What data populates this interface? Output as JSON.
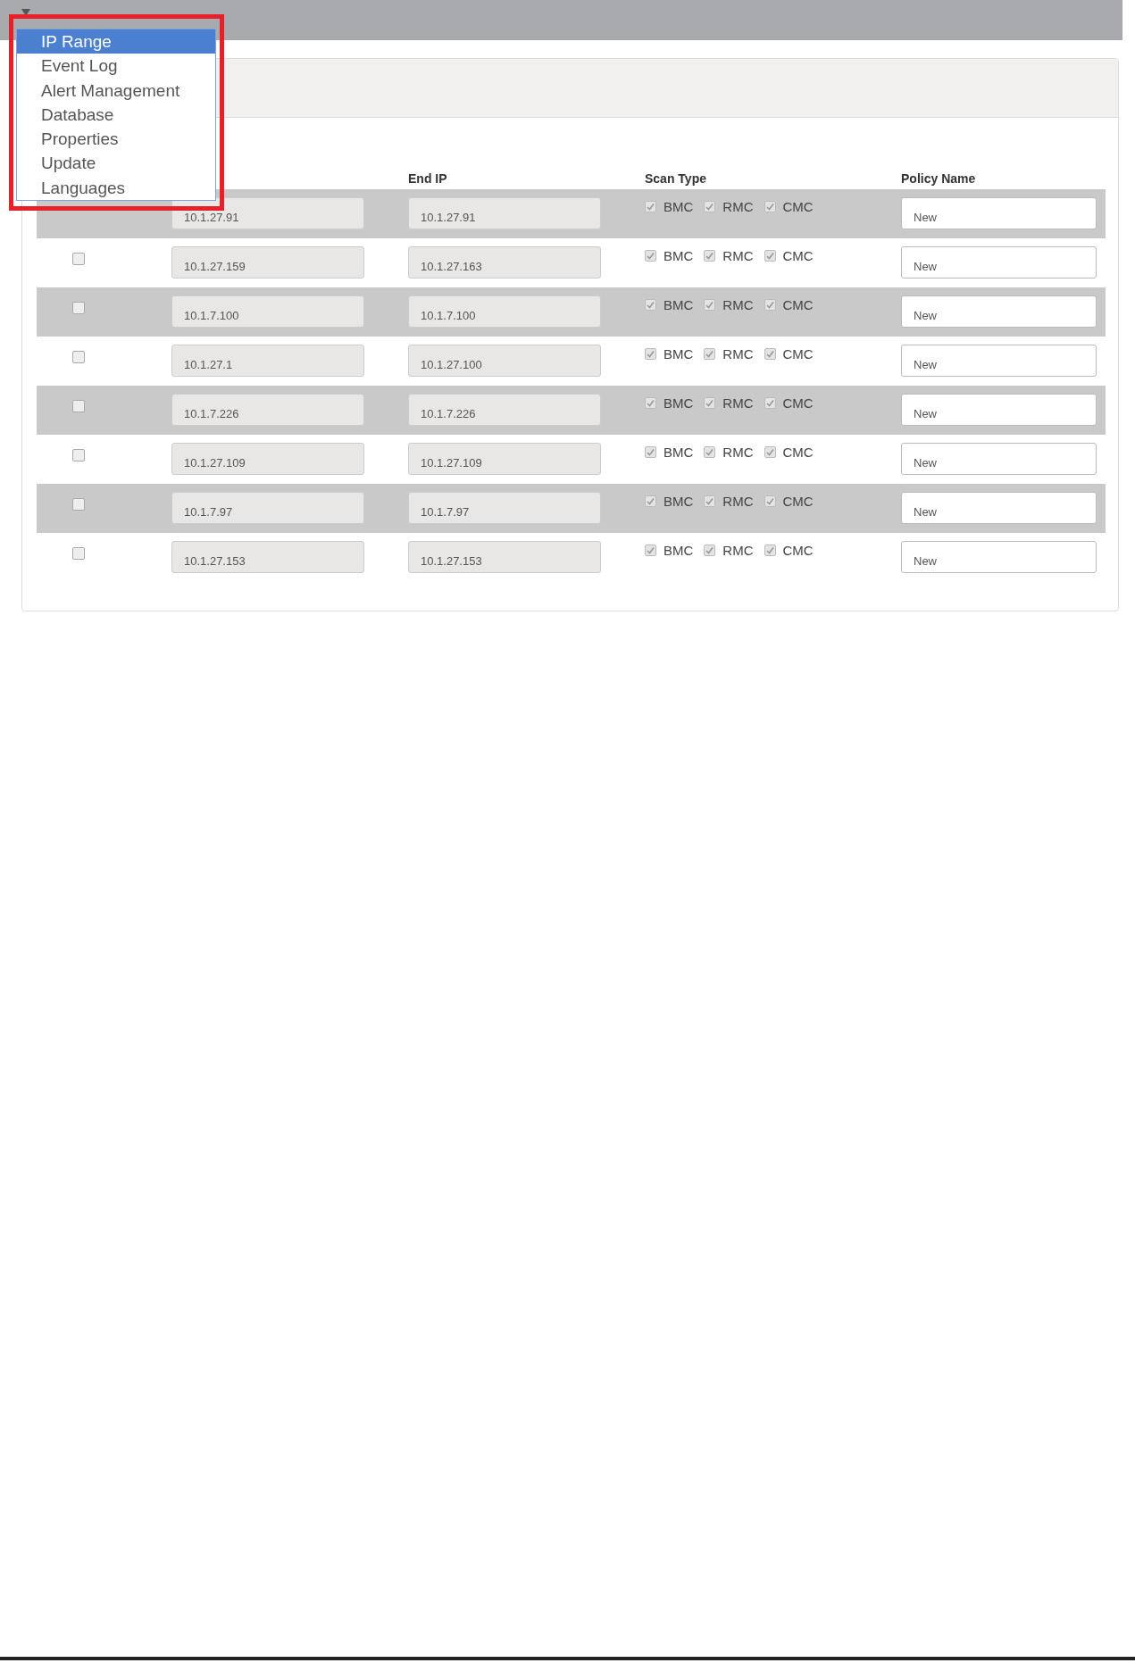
{
  "dropdown": {
    "items": [
      {
        "label": "IP Range",
        "selected": true
      },
      {
        "label": "Event Log",
        "selected": false
      },
      {
        "label": "Alert Management",
        "selected": false
      },
      {
        "label": "Database",
        "selected": false
      },
      {
        "label": "Properties",
        "selected": false
      },
      {
        "label": "Update",
        "selected": false
      },
      {
        "label": "Languages",
        "selected": false
      }
    ]
  },
  "table": {
    "columns": [
      "End IP",
      "Scan Type",
      "Policy Name"
    ],
    "rows": [
      {
        "start_ip": "10.1.27.91",
        "end_ip": "10.1.27.91",
        "scan_types": [
          {
            "label": "BMC",
            "checked": true
          },
          {
            "label": "RMC",
            "checked": true
          },
          {
            "label": "CMC",
            "checked": true
          }
        ],
        "policy_name": "New"
      },
      {
        "checked": false,
        "start_ip": "10.1.27.159",
        "end_ip": "10.1.27.163",
        "scan_types": [
          {
            "label": "BMC",
            "checked": true
          },
          {
            "label": "RMC",
            "checked": true
          },
          {
            "label": "CMC",
            "checked": true
          }
        ],
        "policy_name": "New"
      },
      {
        "checked": false,
        "start_ip": "10.1.7.100",
        "end_ip": "10.1.7.100",
        "scan_types": [
          {
            "label": "BMC",
            "checked": true
          },
          {
            "label": "RMC",
            "checked": true
          },
          {
            "label": "CMC",
            "checked": true
          }
        ],
        "policy_name": "New"
      },
      {
        "checked": false,
        "start_ip": "10.1.27.1",
        "end_ip": "10.1.27.100",
        "scan_types": [
          {
            "label": "BMC",
            "checked": true
          },
          {
            "label": "RMC",
            "checked": true
          },
          {
            "label": "CMC",
            "checked": true
          }
        ],
        "policy_name": "New"
      },
      {
        "checked": false,
        "start_ip": "10.1.7.226",
        "end_ip": "10.1.7.226",
        "scan_types": [
          {
            "label": "BMC",
            "checked": true
          },
          {
            "label": "RMC",
            "checked": true
          },
          {
            "label": "CMC",
            "checked": true
          }
        ],
        "policy_name": "New"
      },
      {
        "checked": false,
        "start_ip": "10.1.27.109",
        "end_ip": "10.1.27.109",
        "scan_types": [
          {
            "label": "BMC",
            "checked": true
          },
          {
            "label": "RMC",
            "checked": true
          },
          {
            "label": "CMC",
            "checked": true
          }
        ],
        "policy_name": "New"
      },
      {
        "checked": false,
        "start_ip": "10.1.7.97",
        "end_ip": "10.1.7.97",
        "scan_types": [
          {
            "label": "BMC",
            "checked": true
          },
          {
            "label": "RMC",
            "checked": true
          },
          {
            "label": "CMC",
            "checked": true
          }
        ],
        "policy_name": "New"
      },
      {
        "checked": false,
        "start_ip": "10.1.27.153",
        "end_ip": "10.1.27.153",
        "scan_types": [
          {
            "label": "BMC",
            "checked": true
          },
          {
            "label": "RMC",
            "checked": true
          },
          {
            "label": "CMC",
            "checked": true
          }
        ],
        "policy_name": "New"
      }
    ]
  }
}
